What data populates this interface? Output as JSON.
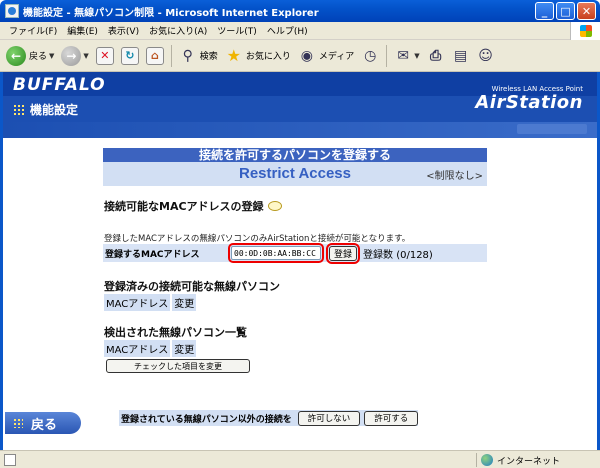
{
  "window": {
    "title": "機能設定 - 無線パソコン制限 - Microsoft Internet Explorer",
    "controls": {
      "minimize": "_",
      "maximize": "□",
      "close": "✕"
    }
  },
  "menu": [
    "ファイル(F)",
    "編集(E)",
    "表示(V)",
    "お気に入り(A)",
    "ツール(T)",
    "ヘルプ(H)"
  ],
  "toolbar": {
    "back": "戻る",
    "search": "検索",
    "favorites": "お気に入り",
    "media": "メディア"
  },
  "banner": {
    "brand": "BUFFALO",
    "page_title": "機能設定",
    "product_sub": "Wireless LAN Access Point",
    "product": "AirStation"
  },
  "section": {
    "title_jp": "接続を許可するパソコンを登録する",
    "title_en": "Restrict Access",
    "limit": "<制限なし>"
  },
  "register": {
    "heading": "接続可能なMACアドレスの登録",
    "description": "登録したMACアドレスの無線パソコンのみAirStationと接続が可能となります。",
    "mac_label": "登録するMACアドレス",
    "mac_value": "00:0D:0B:AA:BB:CC",
    "register_button": "登録",
    "count": "登録数 (0/128)"
  },
  "registered": {
    "heading": "登録済みの接続可能な無線パソコン",
    "col_mac": "MACアドレス",
    "col_change": "変更"
  },
  "detected": {
    "heading": "検出された無線パソコン一覧",
    "col_mac": "MACアドレス",
    "col_change": "変更",
    "change_checked_button": "チェックした項目を変更"
  },
  "back_button": "戻る",
  "others": {
    "label": "登録されている無線パソコン以外の接続を",
    "deny_button": "許可しない",
    "allow_button": "許可する"
  },
  "status": {
    "zone": "インターネット"
  }
}
